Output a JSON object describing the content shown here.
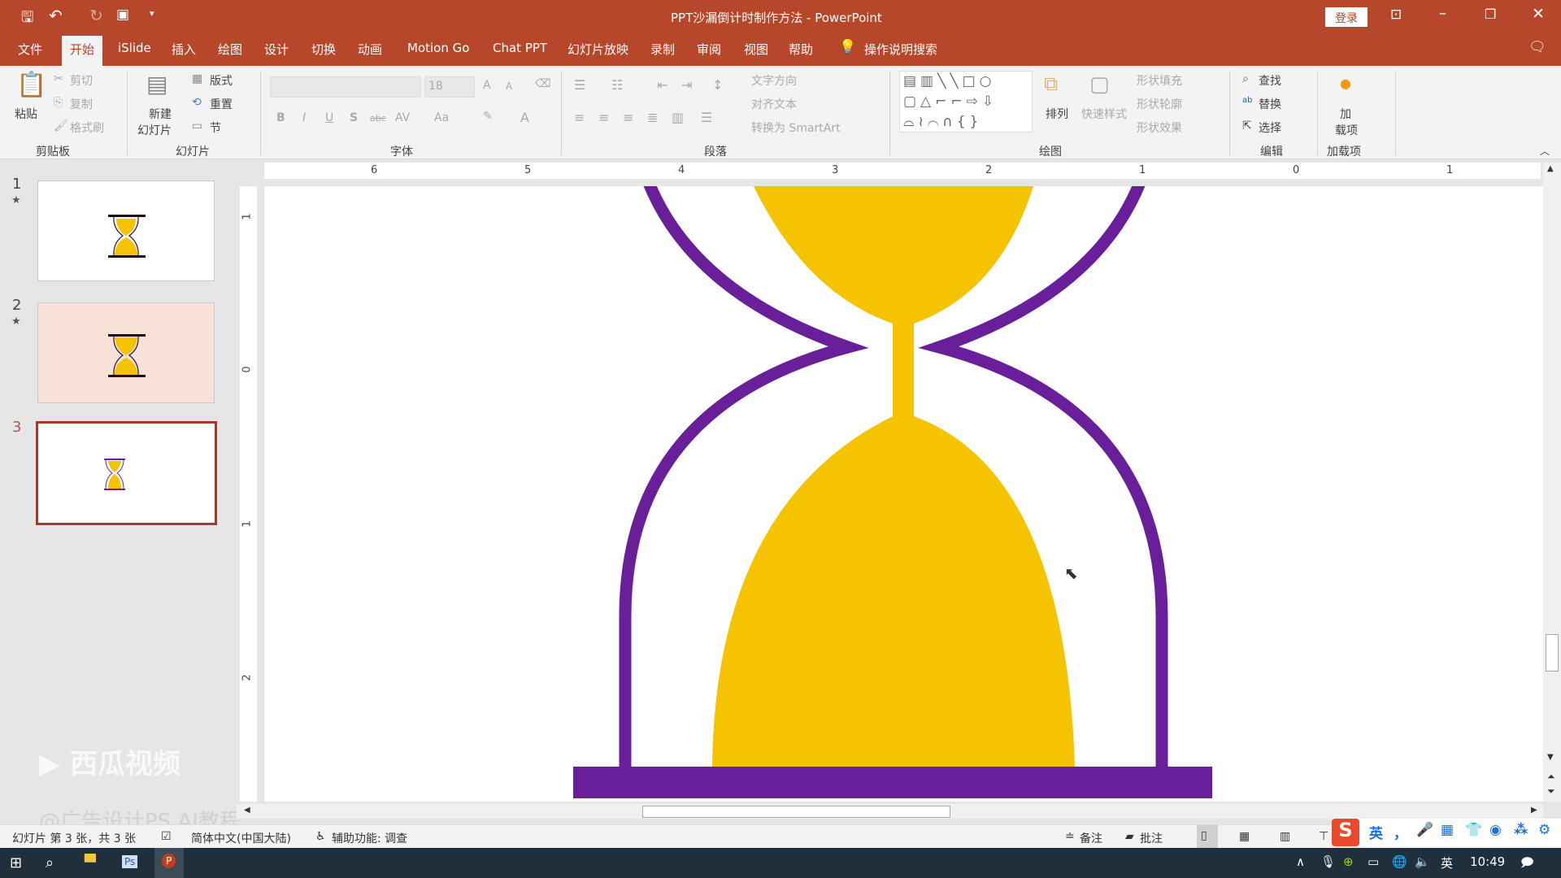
{
  "titlebar": {
    "title": "PPT沙漏倒计时制作方法  -  PowerPoint",
    "login": "登录",
    "icons": [
      "save-icon",
      "undo-icon",
      "redo-icon",
      "present-icon",
      "customize-icon"
    ]
  },
  "menu": [
    "文件",
    "开始",
    "iSlide",
    "插入",
    "绘图",
    "设计",
    "切换",
    "动画",
    "Motion Go",
    "Chat PPT",
    "幻灯片放映",
    "录制",
    "审阅",
    "视图",
    "帮助"
  ],
  "menu_active": "开始",
  "search": "操作说明搜索",
  "ribbon": {
    "clipboard": {
      "paste": "粘贴",
      "cut": "剪切",
      "copy": "复制",
      "format_painter": "格式刷",
      "label": "剪贴板"
    },
    "slides": {
      "new_slide_1": "新建",
      "new_slide_2": "幻灯片",
      "layout": "版式",
      "reset": "重置",
      "section": "节",
      "label": "幻灯片"
    },
    "font": {
      "font_name": "",
      "font_size": "18",
      "bold": "B",
      "italic": "I",
      "underline": "U",
      "shadow": "S",
      "strike": "abc",
      "spacing": "AV",
      "case": "Aa",
      "color": "A",
      "grow": "A",
      "shrink": "A",
      "label": "字体"
    },
    "paragraph": {
      "text_direction": "文字方向",
      "align_text": "对齐文本",
      "smartart": "转换为 SmartArt",
      "label": "段落"
    },
    "drawing": {
      "arrange": "排列",
      "quick_styles": "快速样式",
      "fill": "形状填充",
      "outline": "形状轮廓",
      "effects": "形状效果",
      "label": "绘图"
    },
    "editing": {
      "find": "查找",
      "replace": "替换",
      "select": "选择",
      "label": "编辑"
    },
    "addins": {
      "addins_1": "加",
      "addins_2": "载项",
      "label": "加载项"
    }
  },
  "slides": [
    {
      "number": "1",
      "star": "★",
      "background": "#ffffff"
    },
    {
      "number": "2",
      "star": "★",
      "background": "#f8e2d8"
    },
    {
      "number": "3",
      "star": "",
      "background": "#ffffff",
      "selected": true
    }
  ],
  "ruler": {
    "horizontal": [
      "6",
      "5",
      "4",
      "3",
      "2",
      "1",
      "0",
      "1"
    ],
    "vertical": [
      "1",
      "0",
      "1",
      "2"
    ]
  },
  "colors": {
    "accent": "#b7472a",
    "hourglass_frame": "#6a1f9a",
    "sand": "#f5c300"
  },
  "watermark": {
    "logo": "西瓜视频",
    "credit": "@广告设计PS AI教程"
  },
  "status": {
    "slide_info": "幻灯片 第 3 张，共 3 张",
    "language": "简体中文(中国大陆)",
    "accessibility": "辅助功能: 调查",
    "notes": "备注",
    "comments": "批注"
  },
  "ime": {
    "mode": "英",
    "punct": "，"
  },
  "taskbar": {
    "lang": "英",
    "time": "10:49"
  }
}
